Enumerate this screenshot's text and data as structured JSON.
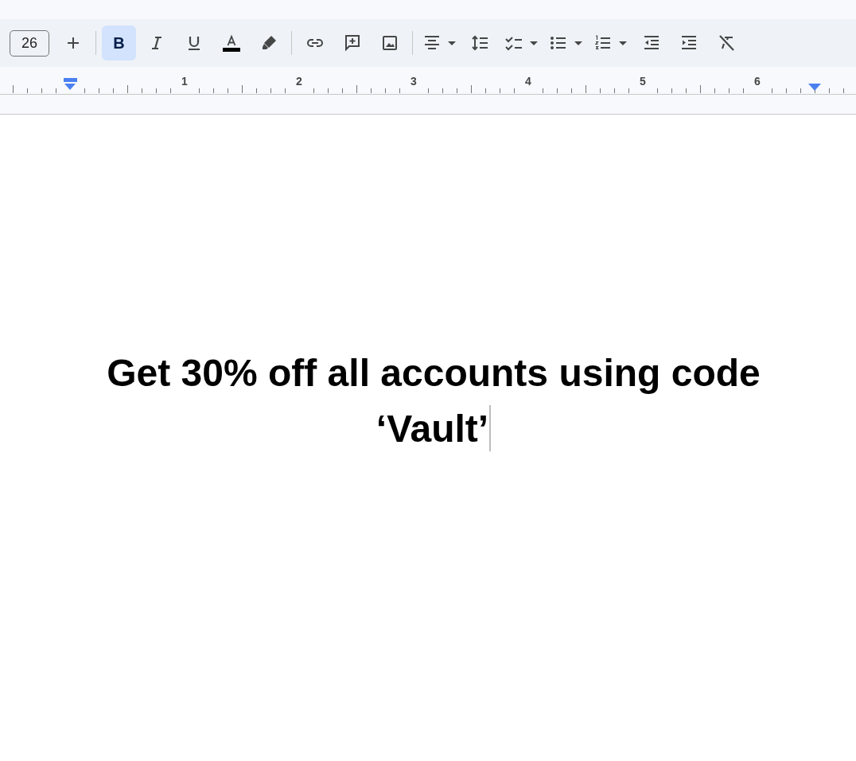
{
  "toolbar": {
    "font_size": "26",
    "groups": [
      [
        {
          "kind": "plus",
          "selected": false
        }
      ],
      [
        {
          "kind": "bold",
          "selected": true,
          "label": "B"
        },
        {
          "kind": "italic",
          "selected": false
        },
        {
          "kind": "underline",
          "selected": false
        },
        {
          "kind": "text_color",
          "selected": false,
          "color": "#000000"
        },
        {
          "kind": "highlight",
          "selected": false
        }
      ],
      [
        {
          "kind": "link",
          "selected": false
        },
        {
          "kind": "comment",
          "selected": false
        },
        {
          "kind": "image",
          "selected": false
        }
      ],
      [
        {
          "kind": "align_center",
          "selected": false
        },
        {
          "kind": "line_spacing",
          "selected": false
        },
        {
          "kind": "checklist",
          "selected": false
        },
        {
          "kind": "bulleted_list",
          "selected": false
        },
        {
          "kind": "numbered_list",
          "selected": false
        },
        {
          "kind": "decrease_indent",
          "selected": false
        },
        {
          "kind": "increase_indent",
          "selected": false
        },
        {
          "kind": "clear_formatting",
          "selected": false
        }
      ]
    ]
  },
  "ruler": {
    "numbers": [
      "1",
      "2",
      "3",
      "4",
      "5",
      "6"
    ]
  },
  "document": {
    "paragraph": "Get 30% off all accounts using code ‘Vault’"
  }
}
